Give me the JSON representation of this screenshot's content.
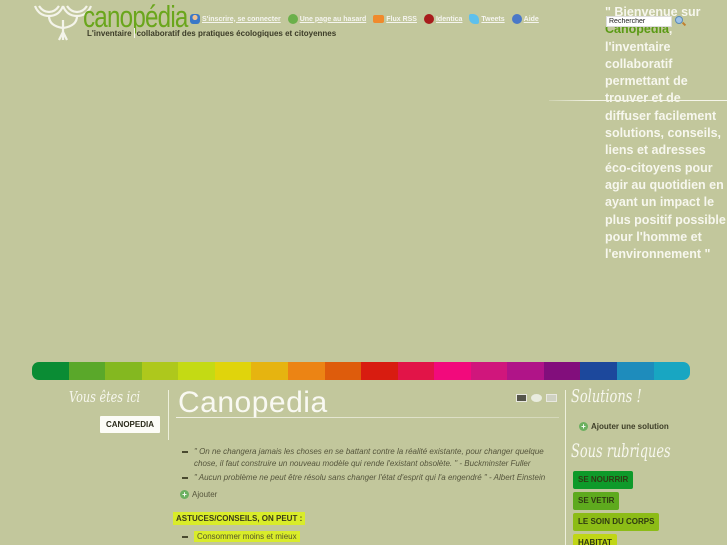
{
  "header": {
    "logo_text": "canopédia",
    "tagline_part1": "L'inventaire",
    "tagline_part2": "collaboratif des pratiques écologiques et citoyennes",
    "nav": [
      {
        "label": "S'inscrire, se connecter",
        "icon": "user-icon"
      },
      {
        "label": "Une page au hasard",
        "icon": "random-icon"
      },
      {
        "label": "Flux RSS",
        "icon": "rss-icon"
      },
      {
        "label": "Identica",
        "icon": "identica-icon"
      },
      {
        "label": "Tweets",
        "icon": "twitter-icon"
      },
      {
        "label": "Aide",
        "icon": "help-icon"
      }
    ]
  },
  "search": {
    "placeholder": "Rechercher",
    "value": "Rechercher"
  },
  "welcome": {
    "open_quote": "\" Bienvenue sur",
    "brand": "Canopedia",
    "body": ", l'inventaire collaboratif permettant de trouver et de diffuser facilement solutions, conseils, liens et adresses éco-citoyens pour agir au quotidien en ayant un impact le plus positif possible pour l'homme et l'environnement",
    "close_quote": " \""
  },
  "colorbar": [
    "#0a8c34",
    "#5aa82a",
    "#84b820",
    "#aec81c",
    "#c4da14",
    "#e0d40c",
    "#e6b410",
    "#ec8414",
    "#de5c0c",
    "#d81c10",
    "#e21448",
    "#f20a7c",
    "#d0167c",
    "#b01488",
    "#820e7c",
    "#1c489c",
    "#1e8cbc",
    "#18a6c2"
  ],
  "breadcrumb": {
    "label": "Vous êtes ici",
    "items": [
      "CANOPEDIA"
    ]
  },
  "main": {
    "title": "Canopedia",
    "tools": [
      "book-icon",
      "comment-icon",
      "email-icon"
    ],
    "quotes": [
      "\" On ne changera jamais les choses en se battant contre la réalité existante, pour changer quelque chose, il faut construire un nouveau modèle qui rende l'existant obsolète. \" - Buckminster Fuller",
      "\" Aucun problème ne peut être résolu sans changer l'état d'esprit qui l'a engendré \" - Albert Einstein"
    ],
    "add_label": "Ajouter",
    "astuces_heading": "ASTUCES/CONSEILS, ON PEUT :",
    "astuces": [
      "Consommer moins et mieux"
    ]
  },
  "sidebar": {
    "solutions_title": "Solutions !",
    "add_solution_label": "Ajouter une solution",
    "sous_rubriques_title": "Sous rubriques",
    "rubriques": [
      {
        "label": "SE NOURRIR",
        "color": "#0e9a2a"
      },
      {
        "label": "SE VETIR",
        "color": "#5eaa1e"
      },
      {
        "label": "LE SOIN DU CORPS",
        "color": "#8cbc16"
      },
      {
        "label": "HABITAT",
        "color": "#c0d616"
      }
    ]
  }
}
